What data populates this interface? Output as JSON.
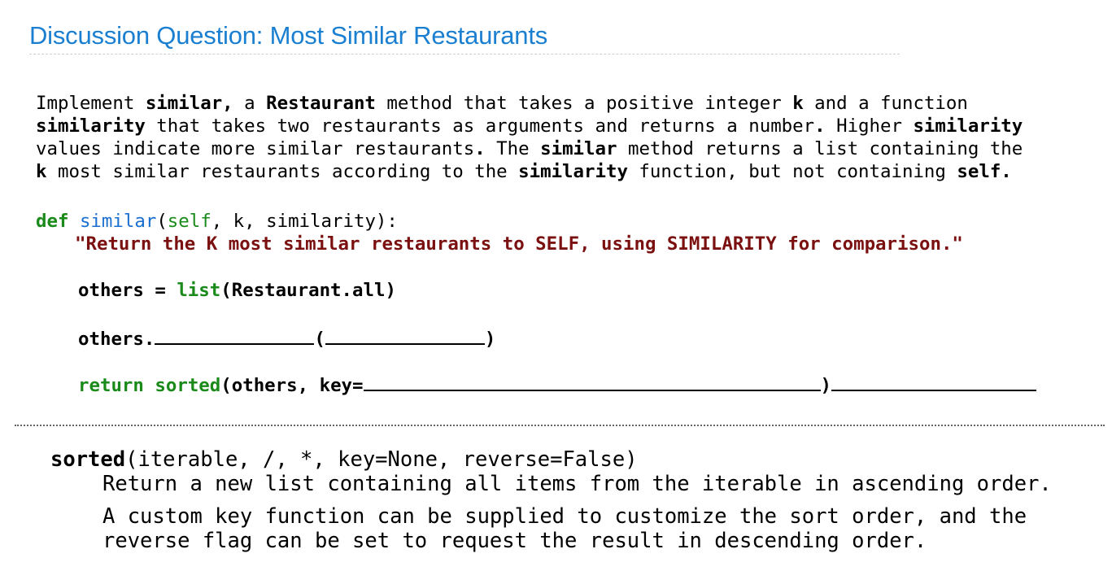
{
  "title": "Discussion Question: Most Similar Restaurants",
  "paragraph": [
    [
      {
        "t": "Implement ",
        "b": false
      },
      {
        "t": "similar,",
        "b": true
      },
      {
        "t": " a ",
        "b": false
      },
      {
        "t": "Restaurant",
        "b": true
      },
      {
        "t": " method that takes a positive integer ",
        "b": false
      },
      {
        "t": "k",
        "b": true
      },
      {
        "t": " and a function",
        "b": false
      }
    ],
    [
      {
        "t": "similarity",
        "b": true
      },
      {
        "t": " that takes two restaurants as arguments and returns a number",
        "b": false
      },
      {
        "t": ".",
        "b": true
      },
      {
        "t": " Higher ",
        "b": false
      },
      {
        "t": "similarity",
        "b": true
      }
    ],
    [
      {
        "t": "values indicate more similar restaurants",
        "b": false
      },
      {
        "t": ".",
        "b": true
      },
      {
        "t": " The ",
        "b": false
      },
      {
        "t": "similar",
        "b": true
      },
      {
        "t": " method returns a list containing the",
        "b": false
      }
    ],
    [
      {
        "t": "k",
        "b": true
      },
      {
        "t": " most similar restaurants according to the ",
        "b": false
      },
      {
        "t": "similarity",
        "b": true
      },
      {
        "t": " function, but not containing ",
        "b": false
      },
      {
        "t": "self.",
        "b": true
      }
    ]
  ],
  "code": {
    "def_kw": "def",
    "func_name": "similar",
    "params": "(",
    "self_param": "self",
    "params_rest": ", k, similarity):",
    "docstring": "\"Return the K most similar restaurants to SELF, using SIMILARITY for comparison.\"",
    "line2_lhs": "others = ",
    "line2_builtin": "list",
    "line2_rest": "(Restaurant.all)",
    "line3_obj": "others.",
    "line3_paren_open": "(",
    "line3_paren_close": ")",
    "line4_return": "return",
    "line4_sorted": "sorted",
    "line4_args": "(others, key=",
    "line4_close": ")"
  },
  "help": {
    "func_name": "sorted",
    "signature": "(iterable, /, *, key=None, reverse=False)",
    "line1": "Return a new list containing all items from the iterable in ascending order.",
    "line2": "A custom key function can be supplied to customize the sort order, and the",
    "line3": "reverse flag can be set to request the result in descending order."
  },
  "colors": {
    "title": "#1a7fd0",
    "keyword": "#1a8a1a",
    "function_name": "#1a6fd0",
    "docstring": "#7a1010"
  }
}
